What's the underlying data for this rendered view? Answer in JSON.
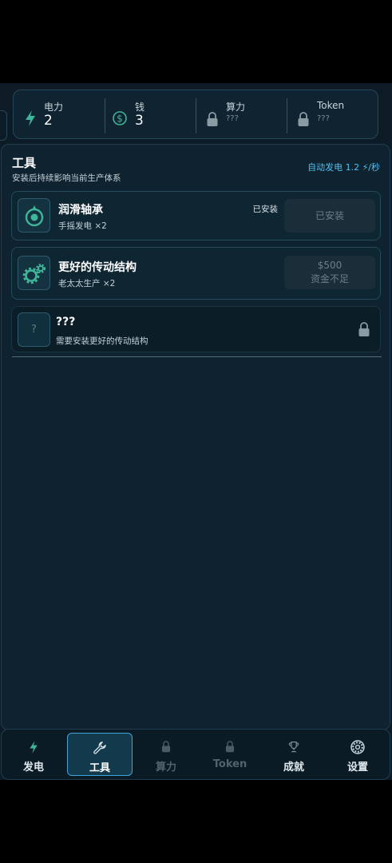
{
  "stats": [
    {
      "label": "电力",
      "value": "2",
      "icon": "bolt-icon",
      "locked": false
    },
    {
      "label": "钱",
      "value": "3",
      "icon": "dollar-icon",
      "locked": false
    },
    {
      "label": "算力",
      "value": "???",
      "icon": "lock-icon",
      "locked": true
    },
    {
      "label": "Token",
      "value": "???",
      "icon": "lock-icon",
      "locked": true
    }
  ],
  "panel": {
    "title": "工具",
    "subtitle": "安装后持续影响当前生产体系",
    "rate": "自动发电 1.2 ⚡/秒"
  },
  "tools": [
    {
      "name": "润滑轴承",
      "desc": "手摇发电 ×2",
      "status_tag": "已安装",
      "button": "已安装",
      "icon": "bearing-icon"
    },
    {
      "name": "更好的传动结构",
      "desc": "老太太生产 ×2",
      "price": "$500",
      "button": "资金不足",
      "icon": "gears-icon"
    },
    {
      "name": "???",
      "desc": "需要安装更好的传动结构",
      "placeholder_icon": "?",
      "icon": "lock-icon"
    }
  ],
  "nav": [
    {
      "label": "发电",
      "icon": "bolt-icon",
      "active": false
    },
    {
      "label": "工具",
      "icon": "wrench-icon",
      "active": true
    },
    {
      "label": "算力",
      "icon": "lock-icon",
      "active": false
    },
    {
      "label": "Token",
      "icon": "lock-icon",
      "active": false
    },
    {
      "label": "成就",
      "icon": "trophy-icon",
      "active": false
    },
    {
      "label": "设置",
      "icon": "gear-icon",
      "active": false
    }
  ],
  "colors": {
    "accent": "#3aa5d8",
    "rate_text": "#4fc0f0",
    "icon_teal": "#3fb59a",
    "background": "#0d1b26"
  }
}
